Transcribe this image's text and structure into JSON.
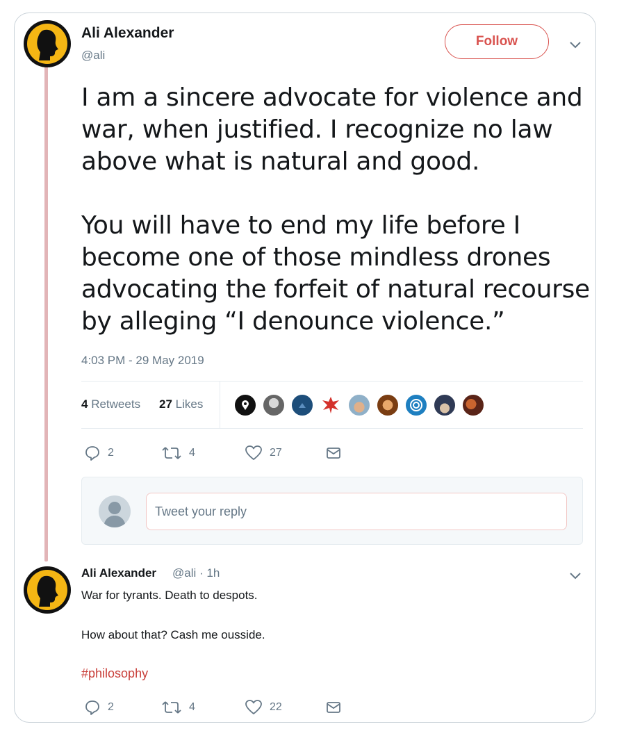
{
  "tweet": {
    "author_name": "Ali Alexander",
    "author_handle": "@ali",
    "follow_label": "Follow",
    "text": "I am a sincere advocate for violence and war, when justified. I recognize no law above what is natural and good.\n\nYou will have to end my life before I become one of those mindless drones advocating the forfeit of natural recourse by alleging “I denounce violence.”",
    "timestamp": "4:03 PM - 29 May 2019",
    "retweets_count": "4",
    "retweets_label": "Retweets",
    "likes_count": "27",
    "likes_label": "Likes",
    "actions": {
      "replies": "2",
      "retweets": "4",
      "likes": "27"
    }
  },
  "likers": [
    {
      "icon": "location-pin-avatar",
      "color": "#111111"
    },
    {
      "icon": "grayscale-face-avatar",
      "color": "#7a7a7a"
    },
    {
      "icon": "blue-mountain-avatar",
      "color": "#1d4e7a"
    },
    {
      "icon": "red-eagle-avatar",
      "color": "#d4312b"
    },
    {
      "icon": "man-cap-avatar",
      "color": "#6b8fa8"
    },
    {
      "icon": "orange-face-avatar",
      "color": "#b5651d"
    },
    {
      "icon": "blue-swirl-avatar",
      "color": "#1e7fc0"
    },
    {
      "icon": "police-cap-avatar",
      "color": "#3c4a66"
    },
    {
      "icon": "red-art-avatar",
      "color": "#8a3a2a"
    }
  ],
  "reply_box": {
    "placeholder": "Tweet your reply"
  },
  "reply": {
    "author_name": "Ali Alexander",
    "meta": "@ali · 1h",
    "line1": "War for tyrants. Death to despots.",
    "line2": "How about that? Cash me ousside.",
    "hashtag": "#philosophy",
    "actions": {
      "replies": "2",
      "retweets": "4",
      "likes": "22"
    }
  },
  "colors": {
    "accent": "#d9534f",
    "muted": "#657786",
    "avatar_gold": "#f5b614"
  }
}
